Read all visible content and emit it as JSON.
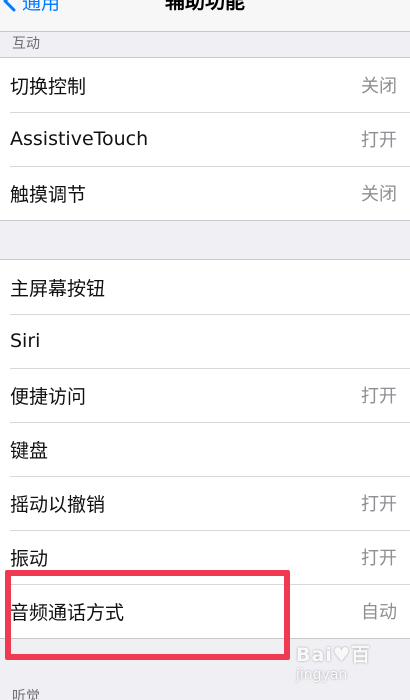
{
  "navbar": {
    "back_label": "通用",
    "title": "辅助功能"
  },
  "sections": {
    "interaction_header": "互动",
    "hearing_header": "听觉"
  },
  "group1": [
    {
      "label": "切换控制",
      "value": "关闭"
    },
    {
      "label": "AssistiveTouch",
      "value": "打开"
    },
    {
      "label": "触摸调节",
      "value": "关闭"
    }
  ],
  "group2": [
    {
      "label": "主屏幕按钮",
      "value": ""
    },
    {
      "label": "Siri",
      "value": ""
    },
    {
      "label": "便捷访问",
      "value": "打开"
    },
    {
      "label": "键盘",
      "value": ""
    },
    {
      "label": "摇动以撤销",
      "value": "打开"
    },
    {
      "label": "振动",
      "value": "打开"
    },
    {
      "label": "音频通话方式",
      "value": "自动"
    }
  ],
  "watermark": {
    "brand": "Bai♥百",
    "sub": "jingyan"
  },
  "colors": {
    "accent": "#007aff",
    "highlight": "#f03a52",
    "background": "#efeff4"
  },
  "icons": {
    "back": "chevron-left-icon"
  }
}
